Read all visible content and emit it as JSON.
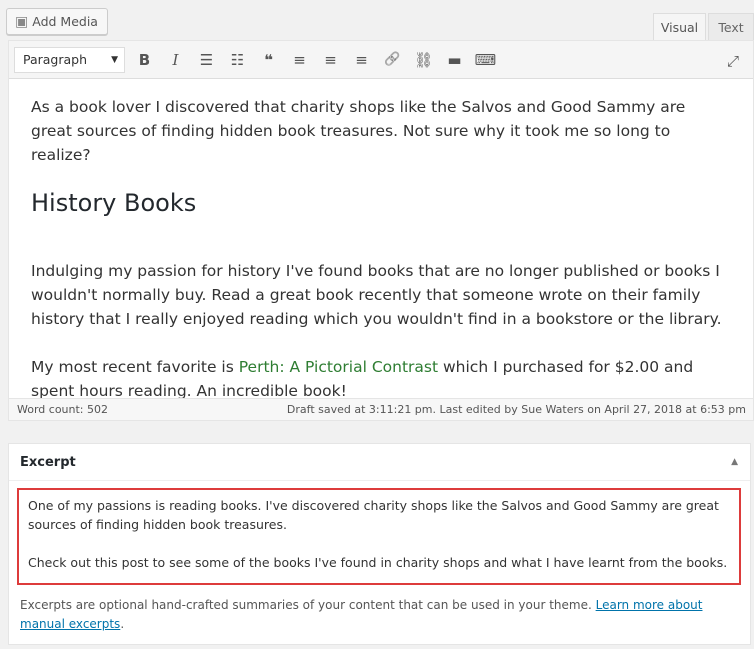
{
  "media": {
    "add_label": "Add Media"
  },
  "tabs": [
    {
      "label": "Visual"
    },
    {
      "label": "Text"
    }
  ],
  "toolbar": {
    "format": "Paragraph",
    "bold": "B",
    "italic": "I",
    "bullet": "☰",
    "numbered": "☷",
    "quote": "❝",
    "align_left": "≡",
    "align_center": "≡",
    "align_right": "≡",
    "link": "🔗",
    "unlink": "⛓",
    "more": "▬",
    "kitchen": "⌨",
    "fullscreen": "⤢"
  },
  "content": {
    "p1": "As a book lover I discovered that charity shops like the Salvos and Good Sammy are great sources of finding hidden book treasures.  Not sure why it took me so long to realize?",
    "h2": "History Books",
    "p2": "Indulging my passion for history I've found books that are no longer published or books I wouldn't normally buy.  Read a great book recently that someone wrote on their family history that I really enjoyed reading which you wouldn't find in a bookstore or the library.",
    "p3_before": "My most recent favorite is ",
    "p3_link": "Perth: A Pictorial Contrast",
    "p3_after": " which I purchased for $2.00 and spent hours reading.  An incredible book!"
  },
  "status": {
    "word_count": "Word count: 502",
    "saved": "Draft saved at 3:11:21 pm. Last edited by Sue Waters on April 27, 2018 at 6:53 pm"
  },
  "excerpt": {
    "title": "Excerpt",
    "toggle": "▲",
    "p1": "One of my passions is reading books.  I've discovered charity shops like the Salvos and Good Sammy are great sources of finding hidden book treasures.",
    "p2": "Check out this post to see some of the books I've found in charity shops and what I have learnt from the books.",
    "help": "Excerpts are optional hand-crafted summaries of your content that can be used in your theme. ",
    "help_link": "Learn more about manual excerpts",
    "help_end": "."
  }
}
